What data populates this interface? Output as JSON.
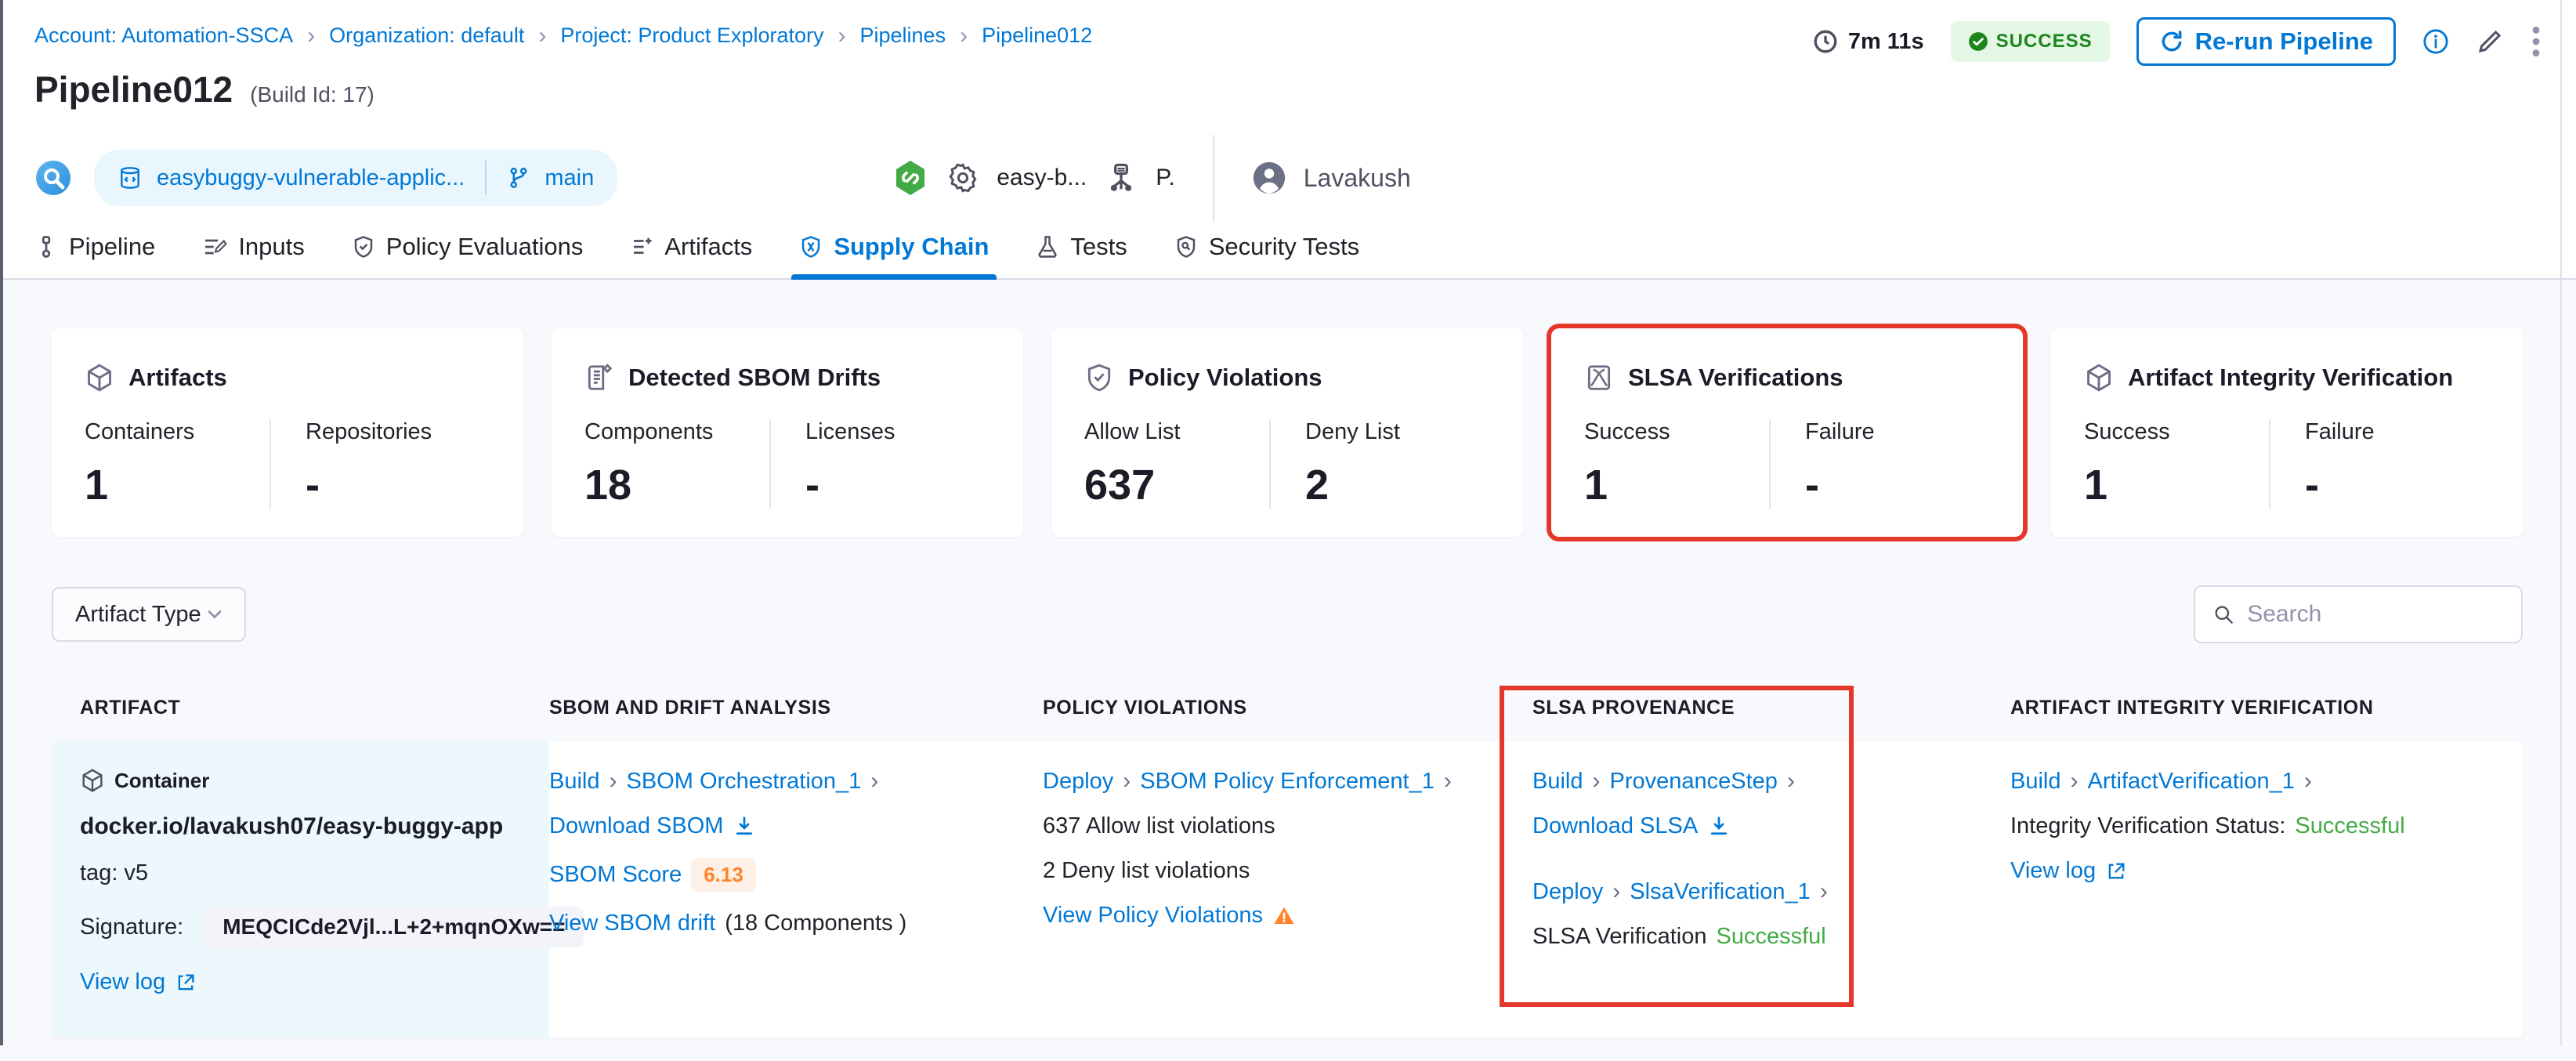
{
  "colors": {
    "accent": "#0278d5",
    "success_green": "#42ab45",
    "highlight_red": "#e3382a",
    "warning_orange": "#ff832b",
    "score_orange": "#ff832b"
  },
  "breadcrumb": {
    "items": [
      "Account: Automation-SSCA",
      "Organization: default",
      "Project: Product Exploratory",
      "Pipelines",
      "Pipeline012"
    ]
  },
  "header": {
    "duration": "7m 11s",
    "status": "SUCCESS",
    "rerun_label": "Re-run Pipeline",
    "title": "Pipeline012",
    "build_id": "(Build Id: 17)",
    "repo": "easybuggy-vulnerable-applic...",
    "branch": "main",
    "service": "easy-b...",
    "infra": "P.",
    "user": "Lavakush"
  },
  "tabs": [
    {
      "label": "Pipeline"
    },
    {
      "label": "Inputs"
    },
    {
      "label": "Policy Evaluations"
    },
    {
      "label": "Artifacts"
    },
    {
      "label": "Supply Chain"
    },
    {
      "label": "Tests"
    },
    {
      "label": "Security Tests"
    }
  ],
  "cards": [
    {
      "title": "Artifacts",
      "metrics": [
        {
          "label": "Containers",
          "value": "1"
        },
        {
          "label": "Repositories",
          "value": "-"
        }
      ]
    },
    {
      "title": "Detected SBOM Drifts",
      "metrics": [
        {
          "label": "Components",
          "value": "18"
        },
        {
          "label": "Licenses",
          "value": "-"
        }
      ]
    },
    {
      "title": "Policy Violations",
      "metrics": [
        {
          "label": "Allow List",
          "value": "637"
        },
        {
          "label": "Deny List",
          "value": "2"
        }
      ]
    },
    {
      "title": "SLSA Verifications",
      "metrics": [
        {
          "label": "Success",
          "value": "1"
        },
        {
          "label": "Failure",
          "value": "-"
        }
      ]
    },
    {
      "title": "Artifact Integrity Verification",
      "metrics": [
        {
          "label": "Success",
          "value": "1"
        },
        {
          "label": "Failure",
          "value": "-"
        }
      ]
    }
  ],
  "filters": {
    "artifact_type_label": "Artifact Type",
    "search_placeholder": "Search"
  },
  "table": {
    "columns": [
      "ARTIFACT",
      "SBOM AND DRIFT ANALYSIS",
      "POLICY VIOLATIONS",
      "SLSA PROVENANCE",
      "ARTIFACT INTEGRITY VERIFICATION"
    ],
    "row": {
      "artifact": {
        "type_label": "Container",
        "name": "docker.io/lavakush07/easy-buggy-app",
        "tag": "tag: v5",
        "signature_label": "Signature:",
        "signature": "MEQCICde2Vjl...L+2+mqnOXw==",
        "view_log": "View log"
      },
      "sbom": {
        "stage": "Build",
        "step": "SBOM Orchestration_1",
        "download": "Download SBOM",
        "score_label": "SBOM Score",
        "score": "6.13",
        "drift_link": "View SBOM drift",
        "drift_suffix": "(18 Components )"
      },
      "policy": {
        "stage": "Deploy",
        "step": "SBOM Policy Enforcement_1",
        "allow": "637 Allow list violations",
        "deny": "2 Deny list violations",
        "view": "View Policy Violations"
      },
      "slsa": {
        "stage1": "Build",
        "step1": "ProvenanceStep",
        "download": "Download SLSA",
        "stage2": "Deploy",
        "step2": "SlsaVerification_1",
        "status_label": "SLSA Verification",
        "status_value": "Successful"
      },
      "integrity": {
        "stage": "Build",
        "step": "ArtifactVerification_1",
        "status_label": "Integrity Verification Status:",
        "status_value": "Successful",
        "view_log": "View log"
      }
    }
  }
}
